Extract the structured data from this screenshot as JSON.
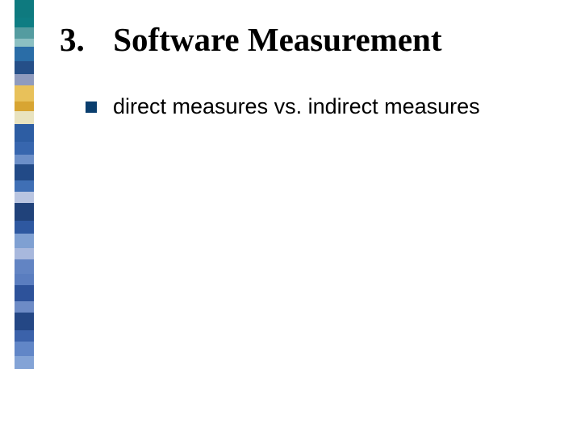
{
  "title": {
    "number": "3.",
    "text": "Software Measurement"
  },
  "bullets": [
    {
      "text": "direct measures vs. indirect measures"
    }
  ],
  "ribbon_colors": [
    "#0e7a7f",
    "#0e7d83",
    "#549ca0",
    "#8cc0c2",
    "#2a6da7",
    "#254f88",
    "#8f9bbe",
    "#e8c15a",
    "#d8a532",
    "#e9e3bf",
    "#2d5da3",
    "#3766ae",
    "#6c8fc8",
    "#224a87",
    "#3f6fb5",
    "#b9c5e1",
    "#20427a",
    "#2e58a0",
    "#7fa0d2",
    "#a8b8dd",
    "#6284c3",
    "#5a7dbf",
    "#2d529a",
    "#6d8bc6",
    "#244785",
    "#3b62aa",
    "#6186c7",
    "#83a3d6",
    "#ffffff",
    "#ffffff"
  ]
}
